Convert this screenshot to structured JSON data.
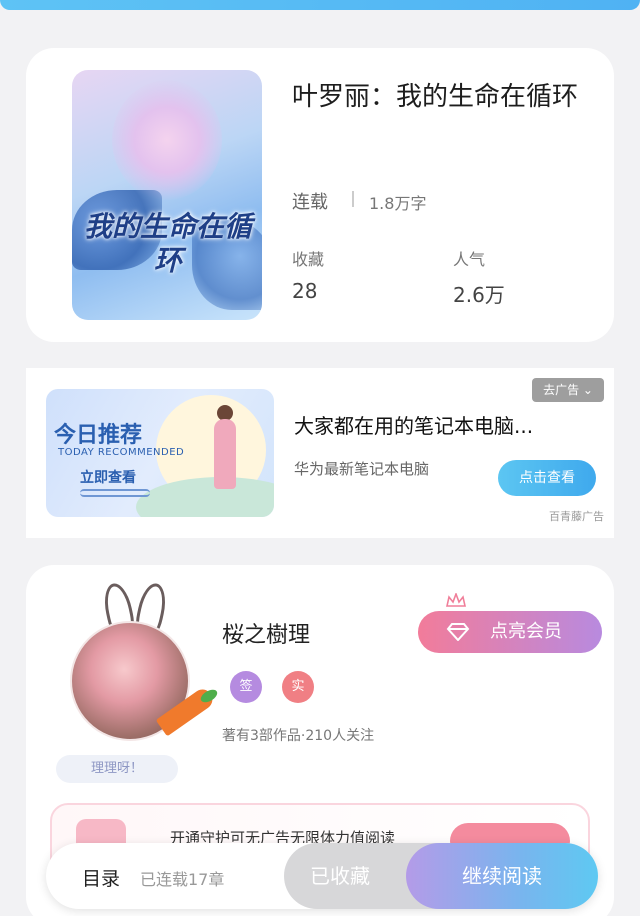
{
  "book": {
    "cover_title": "我的生命在循环",
    "title": "叶罗丽：我的生命在循环",
    "status": "连载",
    "word_count": "1.8万字",
    "favorites_label": "收藏",
    "favorites_value": "28",
    "popularity_label": "人气",
    "popularity_value": "2.6万"
  },
  "ad": {
    "banner_title": "今日推荐",
    "banner_subtitle": "TODAY RECOMMENDED",
    "banner_cta": "立即查看",
    "remove_label": "去广告 ⌄",
    "title": "大家都在用的笔记本电脑...",
    "subtitle": "华为最新笔记本电脑",
    "button_label": "点击查看",
    "source": "百青藤广告"
  },
  "author": {
    "name": "桜之樹理",
    "badge_sign": "签",
    "badge_real": "实",
    "meta": "著有3部作品·210人关注",
    "tag": "理理呀！",
    "vip_button": "点亮会员",
    "guard_text": "开通守护可无广告无限体力值阅读"
  },
  "bottom": {
    "toc_label": "目录",
    "chapters_label": "已连载17章",
    "collected_label": "已收藏",
    "continue_label": "继续阅读"
  },
  "colors": {
    "accent_blue": "#4fb2f3",
    "vip_pink": "#f27c9a",
    "vip_purple": "#b88adf"
  }
}
